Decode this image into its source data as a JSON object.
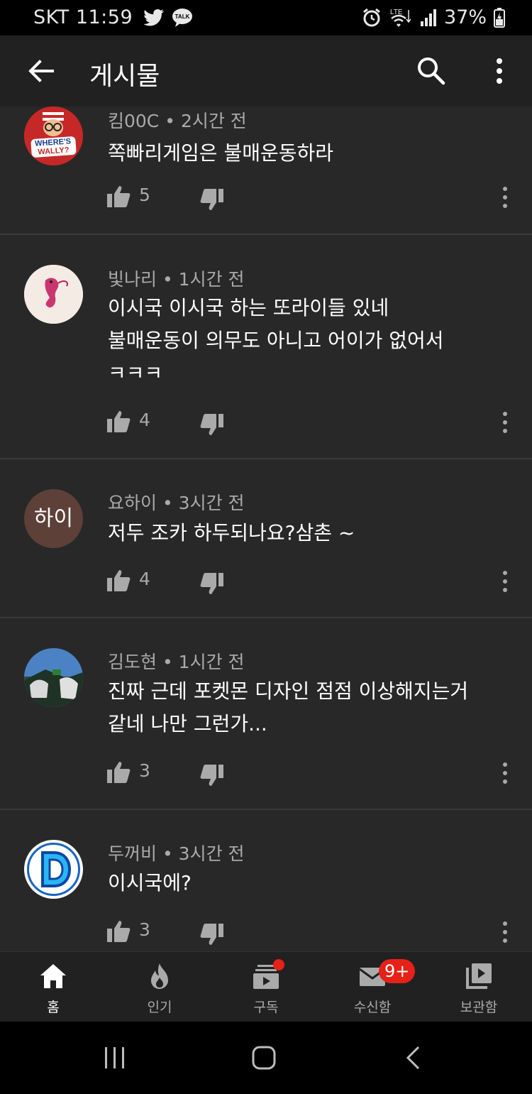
{
  "status_bar": {
    "carrier_time": "SKT 11:59",
    "battery": "37%",
    "network": "LTE"
  },
  "app_bar": {
    "title": "게시물"
  },
  "comments": [
    {
      "author": "킴00C",
      "time": "2시간 전",
      "text": [
        "쪽빠리게임은 불매운동하라"
      ],
      "likes": "5",
      "avatar": "wheres-wally-avatar"
    },
    {
      "author": "빛나리",
      "time": "1시간 전",
      "text": [
        "이시국 이시국 하는 또라이들 있네",
        "불매운동이 의무도 아니고 어이가 없어서",
        "ㅋㅋㅋ"
      ],
      "likes": "4",
      "avatar": "seahorse-avatar"
    },
    {
      "author": "요하이",
      "time": "3시간 전",
      "text": [
        "저두 조카 하두되나요?삼촌 ~"
      ],
      "likes": "4",
      "avatar": "text-avatar",
      "avatar_text": "하이",
      "avatar_color": "#5d4037"
    },
    {
      "author": "김도현",
      "time": "1시간 전",
      "text": [
        "진짜 근데 포켓몬 디자인 점점 이상해지는거",
        "같네 나만 그런가..."
      ],
      "likes": "3",
      "avatar": "photo-avatar"
    },
    {
      "author": "두꺼비",
      "time": "3시간 전",
      "text": [
        "이시국에?"
      ],
      "likes": "3",
      "avatar": "letter-d-avatar",
      "avatar_text": "D"
    }
  ],
  "meta_separator": "•",
  "bottom_nav": [
    {
      "label": "홈",
      "icon": "home-icon",
      "active": true
    },
    {
      "label": "인기",
      "icon": "flame-icon",
      "active": false
    },
    {
      "label": "구독",
      "icon": "subscriptions-icon",
      "active": false,
      "dot": true
    },
    {
      "label": "수신함",
      "icon": "mail-icon",
      "active": false,
      "badge": "9+"
    },
    {
      "label": "보관함",
      "icon": "library-icon",
      "active": false
    }
  ],
  "colors": {
    "background": "#282828",
    "app_bar": "#212121",
    "badge": "#e62117",
    "secondary_text": "#aaaaaa"
  }
}
